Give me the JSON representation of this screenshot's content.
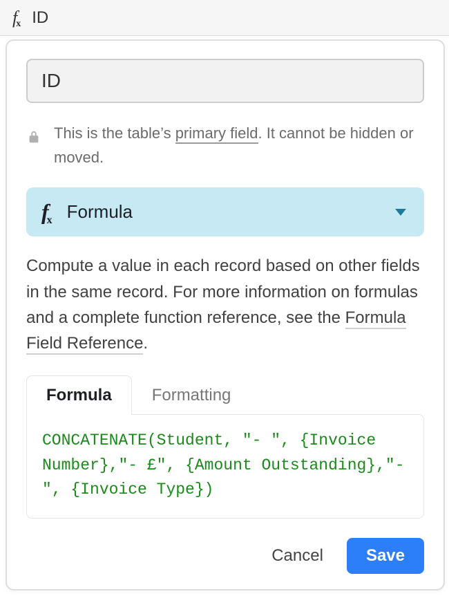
{
  "header": {
    "title": "ID"
  },
  "field": {
    "name": "ID",
    "primary_note_prefix": "This is the table’s ",
    "primary_note_link": "primary field",
    "primary_note_suffix": ". It cannot be hidden or moved."
  },
  "type": {
    "label": "Formula"
  },
  "description": {
    "prefix": "Compute a value in each record based on other fields in the same record. For more information on formulas and a complete function reference, see the ",
    "link": "Formula Field Reference",
    "suffix": "."
  },
  "tabs": {
    "formula": "Formula",
    "formatting": "Formatting"
  },
  "formula": {
    "tokens": [
      {
        "t": "fn",
        "v": "CONCATENATE"
      },
      {
        "t": "paren",
        "v": "("
      },
      {
        "t": "field",
        "v": "Student"
      },
      {
        "t": "comma",
        "v": ", "
      },
      {
        "t": "str",
        "v": "\"- \""
      },
      {
        "t": "comma",
        "v": ", "
      },
      {
        "t": "field",
        "v": "{Invoice Number}"
      },
      {
        "t": "comma",
        "v": ","
      },
      {
        "t": "str",
        "v": "\"- £\""
      },
      {
        "t": "comma",
        "v": ", "
      },
      {
        "t": "field",
        "v": "{Amount Outstanding}"
      },
      {
        "t": "comma",
        "v": ","
      },
      {
        "t": "str",
        "v": "\"- \""
      },
      {
        "t": "comma",
        "v": ", "
      },
      {
        "t": "field",
        "v": "{Invoice Type}"
      },
      {
        "t": "paren",
        "v": ")"
      }
    ]
  },
  "actions": {
    "cancel": "Cancel",
    "save": "Save"
  }
}
